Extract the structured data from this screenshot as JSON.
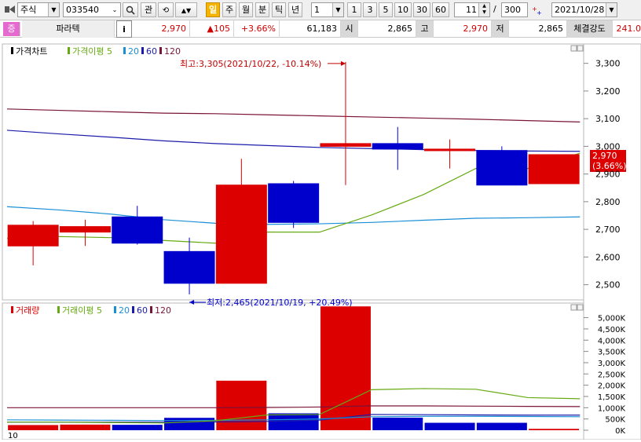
{
  "toolbar": {
    "market_type": "주식",
    "code": "033540",
    "btn_gwan": "관",
    "period_active": "일",
    "periods": [
      "주",
      "월",
      "분",
      "틱",
      "년"
    ],
    "interval_select": "1",
    "intervals": [
      "1",
      "3",
      "5",
      "10",
      "30",
      "60"
    ],
    "visible_count": "11",
    "total_count": "300",
    "date": "2021/10/28"
  },
  "quote": {
    "badge": "증",
    "name": "파라텍",
    "info_btn": "i",
    "price": "2,970",
    "change": "▲105",
    "change_pct": "+3.66%",
    "volume": "61,183",
    "open_label": "시",
    "open": "2,865",
    "high_label": "고",
    "high": "2,970",
    "low_label": "저",
    "low": "2,865",
    "strength_label": "체결강도",
    "strength": "241.0"
  },
  "colors": {
    "up": "#dd0000",
    "down": "#0000cc",
    "ma5": "#66aa11",
    "ma20": "#1a8fd6",
    "ma60": "#1c1caa",
    "ma120": "#7a1438"
  },
  "chart_data": [
    {
      "type": "candlestick",
      "legend": [
        "가격차트",
        "가격이평 5",
        "20",
        "60",
        "120"
      ],
      "y_ticks": [
        "3,300",
        "3,200",
        "3,100",
        "3,000",
        "2,900",
        "2,800",
        "2,700",
        "2,600",
        "2,500"
      ],
      "ylim": [
        2445,
        3370
      ],
      "candles": [
        {
          "o": 2640,
          "h": 2730,
          "l": 2570,
          "c": 2715
        },
        {
          "o": 2690,
          "h": 2735,
          "l": 2640,
          "c": 2710
        },
        {
          "o": 2745,
          "h": 2785,
          "l": 2645,
          "c": 2650
        },
        {
          "o": 2620,
          "h": 2670,
          "l": 2465,
          "c": 2505
        },
        {
          "o": 2505,
          "h": 2955,
          "l": 2505,
          "c": 2860
        },
        {
          "o": 2865,
          "h": 2875,
          "l": 2705,
          "c": 2725
        },
        {
          "o": 3000,
          "h": 3305,
          "l": 2860,
          "c": 3010
        },
        {
          "o": 3010,
          "h": 3070,
          "l": 2915,
          "c": 2990
        },
        {
          "o": 2990,
          "h": 3025,
          "l": 2920,
          "c": 2990
        },
        {
          "o": 2985,
          "h": 3000,
          "l": 2860,
          "c": 2860
        },
        {
          "o": 2865,
          "h": 2970,
          "l": 2865,
          "c": 2970
        }
      ],
      "ma5": [
        2667,
        2674,
        2670,
        2660,
        2650,
        2690,
        2690,
        2752,
        2826,
        2920,
        2920,
        2975
      ],
      "ma20": [
        2782,
        2770,
        2755,
        2735,
        2722,
        2718,
        2720,
        2725,
        2733,
        2740,
        2742,
        2745
      ],
      "ma60": [
        3058,
        3045,
        3033,
        3020,
        3010,
        3003,
        2996,
        2992,
        2988,
        2985,
        2983,
        2982
      ],
      "ma120": [
        3135,
        3130,
        3125,
        3120,
        3118,
        3114,
        3110,
        3106,
        3102,
        3098,
        3093,
        3088
      ],
      "high_annotation": "최고:3,305(2021/10/22, -10.14%)",
      "low_annotation": "최저:2,465(2021/10/19, +20.49%)",
      "current_price_label": "2,970",
      "current_pct_label": "(3.66%)"
    },
    {
      "type": "bar",
      "legend": [
        "거래량",
        "거래이평 5",
        "20",
        "60",
        "120"
      ],
      "y_ticks": [
        "5,000K",
        "4,500K",
        "4,000K",
        "3,500K",
        "3,000K",
        "2,500K",
        "2,000K",
        "1,500K",
        "1,000K",
        "500K",
        "0K"
      ],
      "ylim": [
        0,
        5300
      ],
      "volumes": [
        230,
        250,
        240,
        550,
        2200,
        750,
        5500,
        560,
        330,
        330,
        61
      ],
      "up_days": [
        true,
        true,
        false,
        false,
        true,
        false,
        true,
        false,
        false,
        false,
        true
      ],
      "vma5": [
        360,
        360,
        340,
        320,
        420,
        680,
        700,
        1800,
        1850,
        1820,
        1450,
        1400
      ],
      "vma20": [
        460,
        450,
        440,
        430,
        440,
        460,
        500,
        600,
        620,
        620,
        610,
        600
      ],
      "vma60": [
        360,
        360,
        360,
        360,
        370,
        390,
        450,
        700,
        690,
        680,
        670,
        670
      ],
      "vma120": [
        1000,
        1000,
        1000,
        1000,
        1000,
        1010,
        1030,
        1080,
        1080,
        1070,
        1060,
        1050
      ],
      "x_label": "10"
    }
  ]
}
